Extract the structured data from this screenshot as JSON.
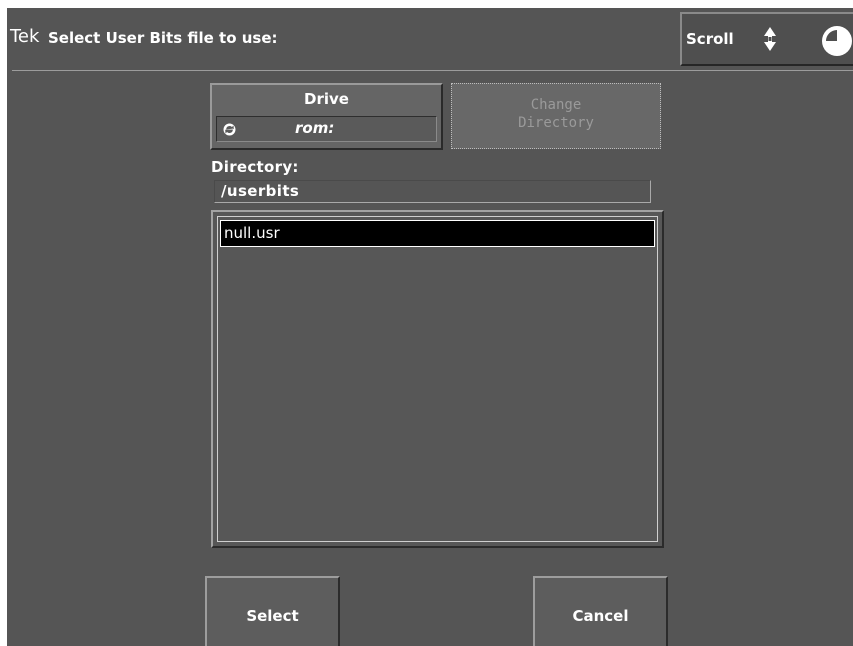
{
  "header": {
    "brand": "Tek",
    "title": "Select User Bits file to use:",
    "scroll_label": "Scroll"
  },
  "drive": {
    "label": "Drive",
    "value": "rom:"
  },
  "change_directory": {
    "label": "Change\nDirectory",
    "enabled": false
  },
  "directory": {
    "heading": "Directory:",
    "path": "/userbits"
  },
  "files": {
    "items": [
      "null.usr"
    ],
    "selected": "null.usr"
  },
  "actions": {
    "select_label": "Select",
    "cancel_label": "Cancel"
  },
  "icons": {
    "scroll": "up-down-arrow-icon",
    "knob": "knob-icon",
    "drive_cycle": "cycle-icon"
  },
  "colors": {
    "background": "#555555",
    "selection": "#000000",
    "text": "#ffffff",
    "disabled_text": "#9a9a9a"
  }
}
